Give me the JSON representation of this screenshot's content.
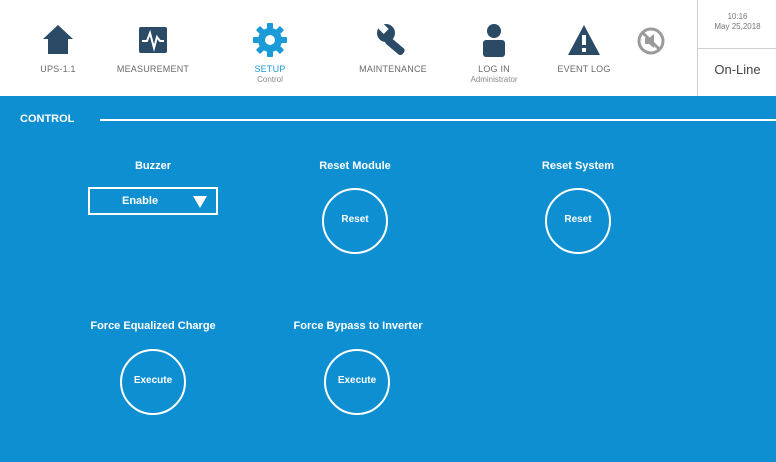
{
  "nav": {
    "items": [
      {
        "label": "UPS-1.1",
        "sub": "",
        "icon": "home-icon"
      },
      {
        "label": "MEASUREMENT",
        "sub": "",
        "icon": "waveform-icon"
      },
      {
        "label": "SETUP",
        "sub": "Control",
        "icon": "gear-icon"
      },
      {
        "label": "MAINTENANCE",
        "sub": "",
        "icon": "wrench-icon"
      },
      {
        "label": "LOG IN",
        "sub": "Administrator",
        "icon": "user-icon"
      },
      {
        "label": "EVENT LOG",
        "sub": "",
        "icon": "warning-icon"
      }
    ],
    "mute_icon": "mute-icon"
  },
  "status": {
    "time": "10:16",
    "date": "May 25,2018",
    "state": "On-Line"
  },
  "control": {
    "header": "CONTROL",
    "buzzer": {
      "label": "Buzzer",
      "value": "Enable"
    },
    "reset_module": {
      "label": "Reset Module",
      "button": "Reset"
    },
    "reset_system": {
      "label": "Reset System",
      "button": "Reset"
    },
    "force_equalized": {
      "label": "Force Equalized Charge",
      "button": "Execute"
    },
    "force_bypass": {
      "label": "Force Bypass to Inverter",
      "button": "Execute"
    }
  },
  "colors": {
    "accent": "#0e8fd2",
    "icon": "#2a4a66",
    "active": "#1a9ad6"
  }
}
